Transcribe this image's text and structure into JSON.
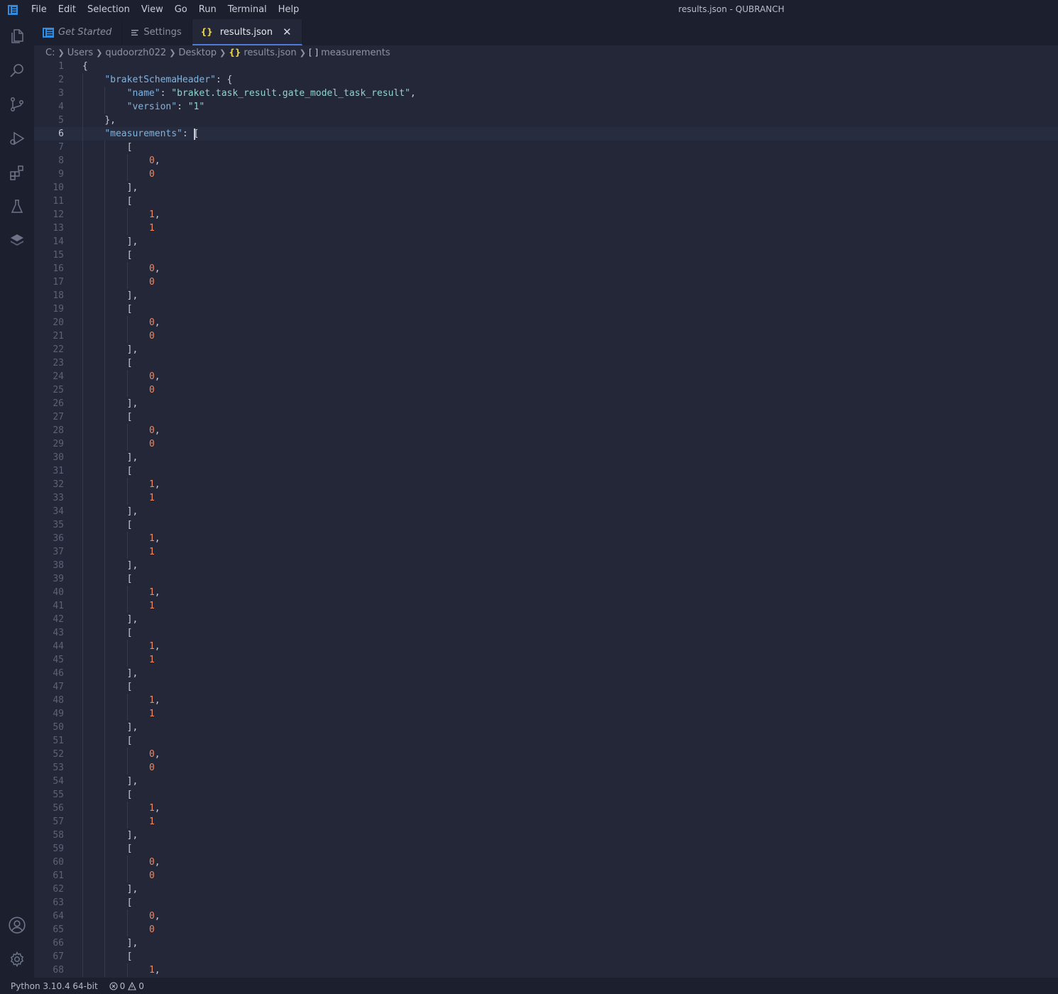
{
  "titlebar": {
    "menu": [
      "File",
      "Edit",
      "Selection",
      "View",
      "Go",
      "Run",
      "Terminal",
      "Help"
    ],
    "window_title": "results.json - QUBRANCH"
  },
  "activity_bar": {
    "top_icons": [
      "explorer-icon",
      "search-icon",
      "source-control-icon",
      "run-debug-icon",
      "extensions-icon",
      "testing-flask-icon",
      "layers-icon"
    ],
    "bottom_icons": [
      "account-icon",
      "gear-icon"
    ]
  },
  "tabs": [
    {
      "label": "Get Started",
      "icon": "vscode-logo-icon",
      "active": false
    },
    {
      "label": "Settings",
      "icon": "settings-list-icon",
      "active": false
    },
    {
      "label": "results.json",
      "icon": "json-braces-icon",
      "active": true,
      "close": "✕"
    }
  ],
  "breadcrumb": {
    "parts": [
      "C:",
      "Users",
      "qudoorzh022",
      "Desktop"
    ],
    "file": "results.json",
    "file_icon": "{}",
    "symbol": "measurements",
    "symbol_icon": "[ ]"
  },
  "editor": {
    "current_line": 6,
    "lines": [
      [
        {
          "t": "{",
          "c": "p"
        }
      ],
      [
        {
          "t": "\"braketSchemaHeader\"",
          "c": "k"
        },
        {
          "t": ": {",
          "c": "p"
        }
      ],
      [
        {
          "t": "\"name\"",
          "c": "k"
        },
        {
          "t": ": ",
          "c": "p"
        },
        {
          "t": "\"braket.task_result.gate_model_task_result\"",
          "c": "s"
        },
        {
          "t": ",",
          "c": "p"
        }
      ],
      [
        {
          "t": "\"version\"",
          "c": "k"
        },
        {
          "t": ": ",
          "c": "p"
        },
        {
          "t": "\"1\"",
          "c": "s"
        }
      ],
      [
        {
          "t": "},",
          "c": "p"
        }
      ],
      [
        {
          "t": "\"measurements\"",
          "c": "k"
        },
        {
          "t": ": ",
          "c": "p"
        },
        {
          "t": "[",
          "c": "p"
        }
      ],
      [
        {
          "t": "[",
          "c": "p"
        }
      ],
      [
        {
          "t": "0",
          "c": "n"
        },
        {
          "t": ",",
          "c": "p"
        }
      ],
      [
        {
          "t": "0",
          "c": "n"
        }
      ],
      [
        {
          "t": "],",
          "c": "p"
        }
      ],
      [
        {
          "t": "[",
          "c": "p"
        }
      ],
      [
        {
          "t": "1",
          "c": "n"
        },
        {
          "t": ",",
          "c": "p"
        }
      ],
      [
        {
          "t": "1",
          "c": "n"
        }
      ],
      [
        {
          "t": "],",
          "c": "p"
        }
      ],
      [
        {
          "t": "[",
          "c": "p"
        }
      ],
      [
        {
          "t": "0",
          "c": "n"
        },
        {
          "t": ",",
          "c": "p"
        }
      ],
      [
        {
          "t": "0",
          "c": "n"
        }
      ],
      [
        {
          "t": "],",
          "c": "p"
        }
      ],
      [
        {
          "t": "[",
          "c": "p"
        }
      ],
      [
        {
          "t": "0",
          "c": "n"
        },
        {
          "t": ",",
          "c": "p"
        }
      ],
      [
        {
          "t": "0",
          "c": "n"
        }
      ],
      [
        {
          "t": "],",
          "c": "p"
        }
      ],
      [
        {
          "t": "[",
          "c": "p"
        }
      ],
      [
        {
          "t": "0",
          "c": "n"
        },
        {
          "t": ",",
          "c": "p"
        }
      ],
      [
        {
          "t": "0",
          "c": "n"
        }
      ],
      [
        {
          "t": "],",
          "c": "p"
        }
      ],
      [
        {
          "t": "[",
          "c": "p"
        }
      ],
      [
        {
          "t": "0",
          "c": "n"
        },
        {
          "t": ",",
          "c": "p"
        }
      ],
      [
        {
          "t": "0",
          "c": "n"
        }
      ],
      [
        {
          "t": "],",
          "c": "p"
        }
      ],
      [
        {
          "t": "[",
          "c": "p"
        }
      ],
      [
        {
          "t": "1",
          "c": "n"
        },
        {
          "t": ",",
          "c": "p"
        }
      ],
      [
        {
          "t": "1",
          "c": "n"
        }
      ],
      [
        {
          "t": "],",
          "c": "p"
        }
      ],
      [
        {
          "t": "[",
          "c": "p"
        }
      ],
      [
        {
          "t": "1",
          "c": "n"
        },
        {
          "t": ",",
          "c": "p"
        }
      ],
      [
        {
          "t": "1",
          "c": "n"
        }
      ],
      [
        {
          "t": "],",
          "c": "p"
        }
      ],
      [
        {
          "t": "[",
          "c": "p"
        }
      ],
      [
        {
          "t": "1",
          "c": "n"
        },
        {
          "t": ",",
          "c": "p"
        }
      ],
      [
        {
          "t": "1",
          "c": "n"
        }
      ],
      [
        {
          "t": "],",
          "c": "p"
        }
      ],
      [
        {
          "t": "[",
          "c": "p"
        }
      ],
      [
        {
          "t": "1",
          "c": "n"
        },
        {
          "t": ",",
          "c": "p"
        }
      ],
      [
        {
          "t": "1",
          "c": "n"
        }
      ],
      [
        {
          "t": "],",
          "c": "p"
        }
      ],
      [
        {
          "t": "[",
          "c": "p"
        }
      ],
      [
        {
          "t": "1",
          "c": "n"
        },
        {
          "t": ",",
          "c": "p"
        }
      ],
      [
        {
          "t": "1",
          "c": "n"
        }
      ],
      [
        {
          "t": "],",
          "c": "p"
        }
      ],
      [
        {
          "t": "[",
          "c": "p"
        }
      ],
      [
        {
          "t": "0",
          "c": "n"
        },
        {
          "t": ",",
          "c": "p"
        }
      ],
      [
        {
          "t": "0",
          "c": "n"
        }
      ],
      [
        {
          "t": "],",
          "c": "p"
        }
      ],
      [
        {
          "t": "[",
          "c": "p"
        }
      ],
      [
        {
          "t": "1",
          "c": "n"
        },
        {
          "t": ",",
          "c": "p"
        }
      ],
      [
        {
          "t": "1",
          "c": "n"
        }
      ],
      [
        {
          "t": "],",
          "c": "p"
        }
      ],
      [
        {
          "t": "[",
          "c": "p"
        }
      ],
      [
        {
          "t": "0",
          "c": "n"
        },
        {
          "t": ",",
          "c": "p"
        }
      ],
      [
        {
          "t": "0",
          "c": "n"
        }
      ],
      [
        {
          "t": "],",
          "c": "p"
        }
      ],
      [
        {
          "t": "[",
          "c": "p"
        }
      ],
      [
        {
          "t": "0",
          "c": "n"
        },
        {
          "t": ",",
          "c": "p"
        }
      ],
      [
        {
          "t": "0",
          "c": "n"
        }
      ],
      [
        {
          "t": "],",
          "c": "p"
        }
      ],
      [
        {
          "t": "[",
          "c": "p"
        }
      ],
      [
        {
          "t": "1",
          "c": "n"
        },
        {
          "t": ",",
          "c": "p"
        }
      ]
    ],
    "indents": [
      0,
      1,
      2,
      2,
      1,
      1,
      2,
      3,
      3,
      2,
      2,
      3,
      3,
      2,
      2,
      3,
      3,
      2,
      2,
      3,
      3,
      2,
      2,
      3,
      3,
      2,
      2,
      3,
      3,
      2,
      2,
      3,
      3,
      2,
      2,
      3,
      3,
      2,
      2,
      3,
      3,
      2,
      2,
      3,
      3,
      2,
      2,
      3,
      3,
      2,
      2,
      3,
      3,
      2,
      2,
      3,
      3,
      2,
      2,
      3,
      3,
      2,
      2,
      3,
      3,
      2,
      2,
      3
    ]
  },
  "statusbar": {
    "python": "Python 3.10.4 64-bit",
    "errors": "0",
    "warnings": "0"
  },
  "colors": {
    "background": "#232738",
    "chrome": "#1c1f2d",
    "key": "#7fb3e0",
    "string": "#93d3cf",
    "number": "#ef8863",
    "active_tab_border": "#4e7bd9"
  }
}
